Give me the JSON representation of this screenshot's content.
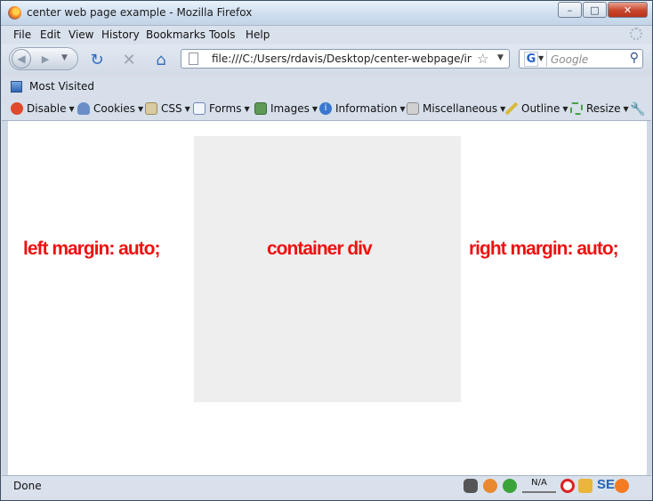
{
  "window": {
    "title": "center web page example - Mozilla Firefox"
  },
  "menubar": {
    "items": [
      {
        "label": "File",
        "name": "menu-file"
      },
      {
        "label": "Edit",
        "name": "menu-edit"
      },
      {
        "label": "View",
        "name": "menu-view"
      },
      {
        "label": "History",
        "name": "menu-history"
      },
      {
        "label": "Bookmarks",
        "name": "menu-bookmarks"
      },
      {
        "label": "Tools",
        "name": "menu-tools"
      },
      {
        "label": "Help",
        "name": "menu-help"
      }
    ]
  },
  "navbar": {
    "url": "file:///C:/Users/rdavis/Desktop/center-webpage/index.html",
    "search_placeholder": "Google"
  },
  "bookmarks": {
    "most_visited": "Most Visited"
  },
  "devbar": {
    "items": [
      {
        "label": "Disable",
        "icon": "disable-icon",
        "color": "#e04a2b"
      },
      {
        "label": "Cookies",
        "icon": "cookies-icon",
        "color": "#6a8fc8"
      },
      {
        "label": "CSS",
        "icon": "css-icon",
        "color": "#c8b36a"
      },
      {
        "label": "Forms",
        "icon": "forms-icon",
        "color": "#8aa8d8"
      },
      {
        "label": "Images",
        "icon": "images-icon",
        "color": "#5e9a56"
      },
      {
        "label": "Information",
        "icon": "information-icon",
        "color": "#3a78d0"
      },
      {
        "label": "Miscellaneous",
        "icon": "miscellaneous-icon",
        "color": "#b8b8b8"
      },
      {
        "label": "Outline",
        "icon": "outline-icon",
        "color": "#d9b93a"
      },
      {
        "label": "Resize",
        "icon": "resize-icon",
        "color": "#4aa04a"
      }
    ]
  },
  "page": {
    "left_label": "left margin: auto;",
    "center_label": "container div",
    "right_label": "right margin: auto;",
    "container_color": "#eeeeee",
    "label_color": "#ee1111"
  },
  "statusbar": {
    "text": "Done",
    "na_text": "N/A",
    "seo_text": "SE"
  }
}
